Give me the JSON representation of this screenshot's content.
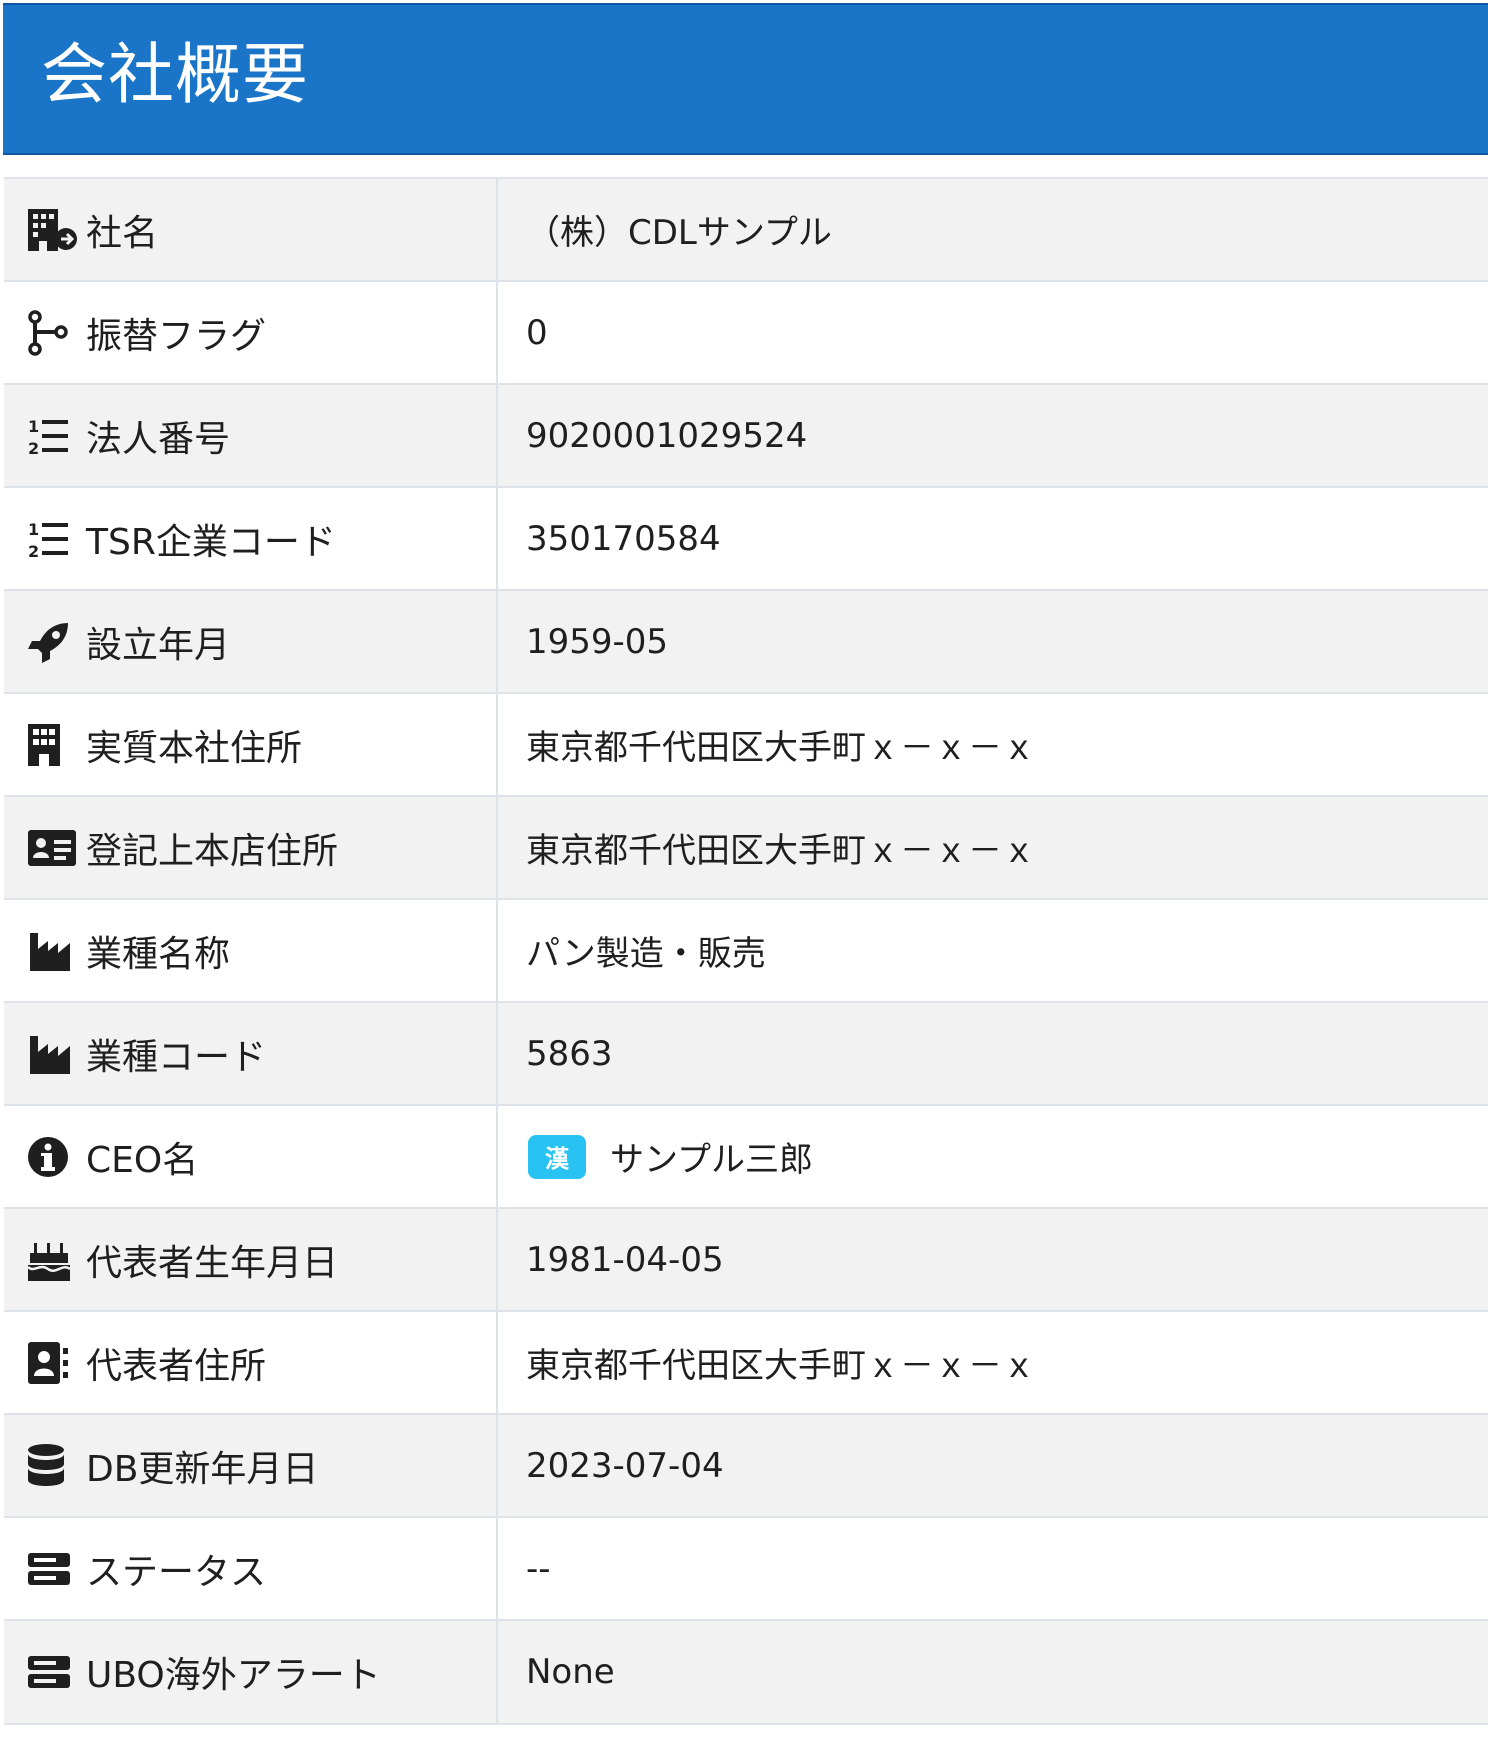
{
  "header": {
    "title": "会社概要"
  },
  "colors": {
    "header_bg": "#1a74c8",
    "row_alt": "#f2f2f2",
    "row_plain": "#ffffff",
    "border": "#dde3e8",
    "badge": "#29c3f3"
  },
  "rows": [
    {
      "icon": "building-add-icon",
      "label": "社名",
      "value": "（株）CDLサンプル"
    },
    {
      "icon": "branch-icon",
      "label": "振替フラグ",
      "value": "0"
    },
    {
      "icon": "numbered-list-icon",
      "label": "法人番号",
      "value": "9020001029524"
    },
    {
      "icon": "numbered-list-icon",
      "label": "TSR企業コード",
      "value": "350170584"
    },
    {
      "icon": "rocket-icon",
      "label": "設立年月",
      "value": "1959-05"
    },
    {
      "icon": "building-icon",
      "label": "実質本社住所",
      "value": "東京都千代田区大手町ｘ－ｘ－ｘ"
    },
    {
      "icon": "id-card-icon",
      "label": "登記上本店住所",
      "value": "東京都千代田区大手町ｘ－ｘ－ｘ"
    },
    {
      "icon": "industry-icon",
      "label": "業種名称",
      "value": "パン製造・販売"
    },
    {
      "icon": "industry-icon",
      "label": "業種コード",
      "value": "5863"
    },
    {
      "icon": "info-circle-icon",
      "label": "CEO名",
      "badge": "漢",
      "value": "サンプル三郎"
    },
    {
      "icon": "birthday-cake-icon",
      "label": "代表者生年月日",
      "value": "1981-04-05"
    },
    {
      "icon": "address-book-icon",
      "label": "代表者住所",
      "value": "東京都千代田区大手町ｘ－ｘ－ｘ"
    },
    {
      "icon": "database-icon",
      "label": "DB更新年月日",
      "value": "2023-07-04"
    },
    {
      "icon": "server-icon",
      "label": "ステータス",
      "value": "--"
    },
    {
      "icon": "server-icon",
      "label": "UBO海外アラート",
      "value": "None"
    }
  ]
}
